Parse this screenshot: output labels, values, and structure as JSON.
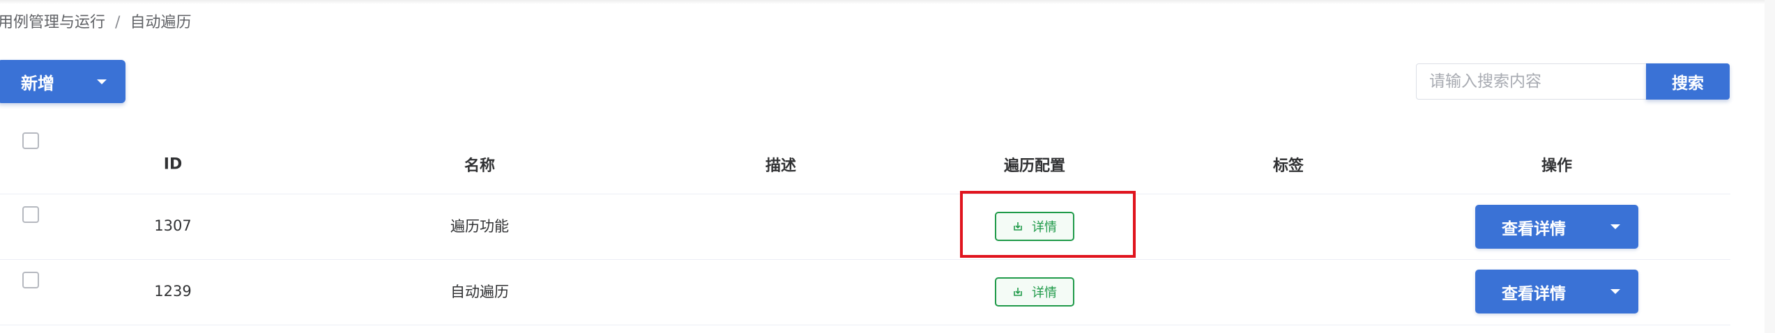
{
  "breadcrumb": {
    "parent": "用例管理与运行",
    "separator": "/",
    "current": "自动遍历"
  },
  "toolbar": {
    "add_label": "新增",
    "search_placeholder": "请输入搜索内容",
    "search_label": "搜索"
  },
  "table": {
    "columns": [
      "ID",
      "名称",
      "描述",
      "遍历配置",
      "标签",
      "操作"
    ],
    "rows": [
      {
        "id": "1307",
        "name": "遍历功能",
        "description": "",
        "config": "详情",
        "tags": "",
        "action": "查看详情"
      },
      {
        "id": "1239",
        "name": "自动遍历",
        "description": "",
        "config": "详情",
        "tags": "",
        "action": "查看详情"
      }
    ]
  },
  "colors": {
    "primary": "#3a72d6",
    "success": "#1f9a49",
    "highlight": "#e0141e"
  },
  "icons": {
    "add_dropdown": "caret-down-icon",
    "detail": "download-icon",
    "row_action_dropdown": "caret-down-icon"
  }
}
